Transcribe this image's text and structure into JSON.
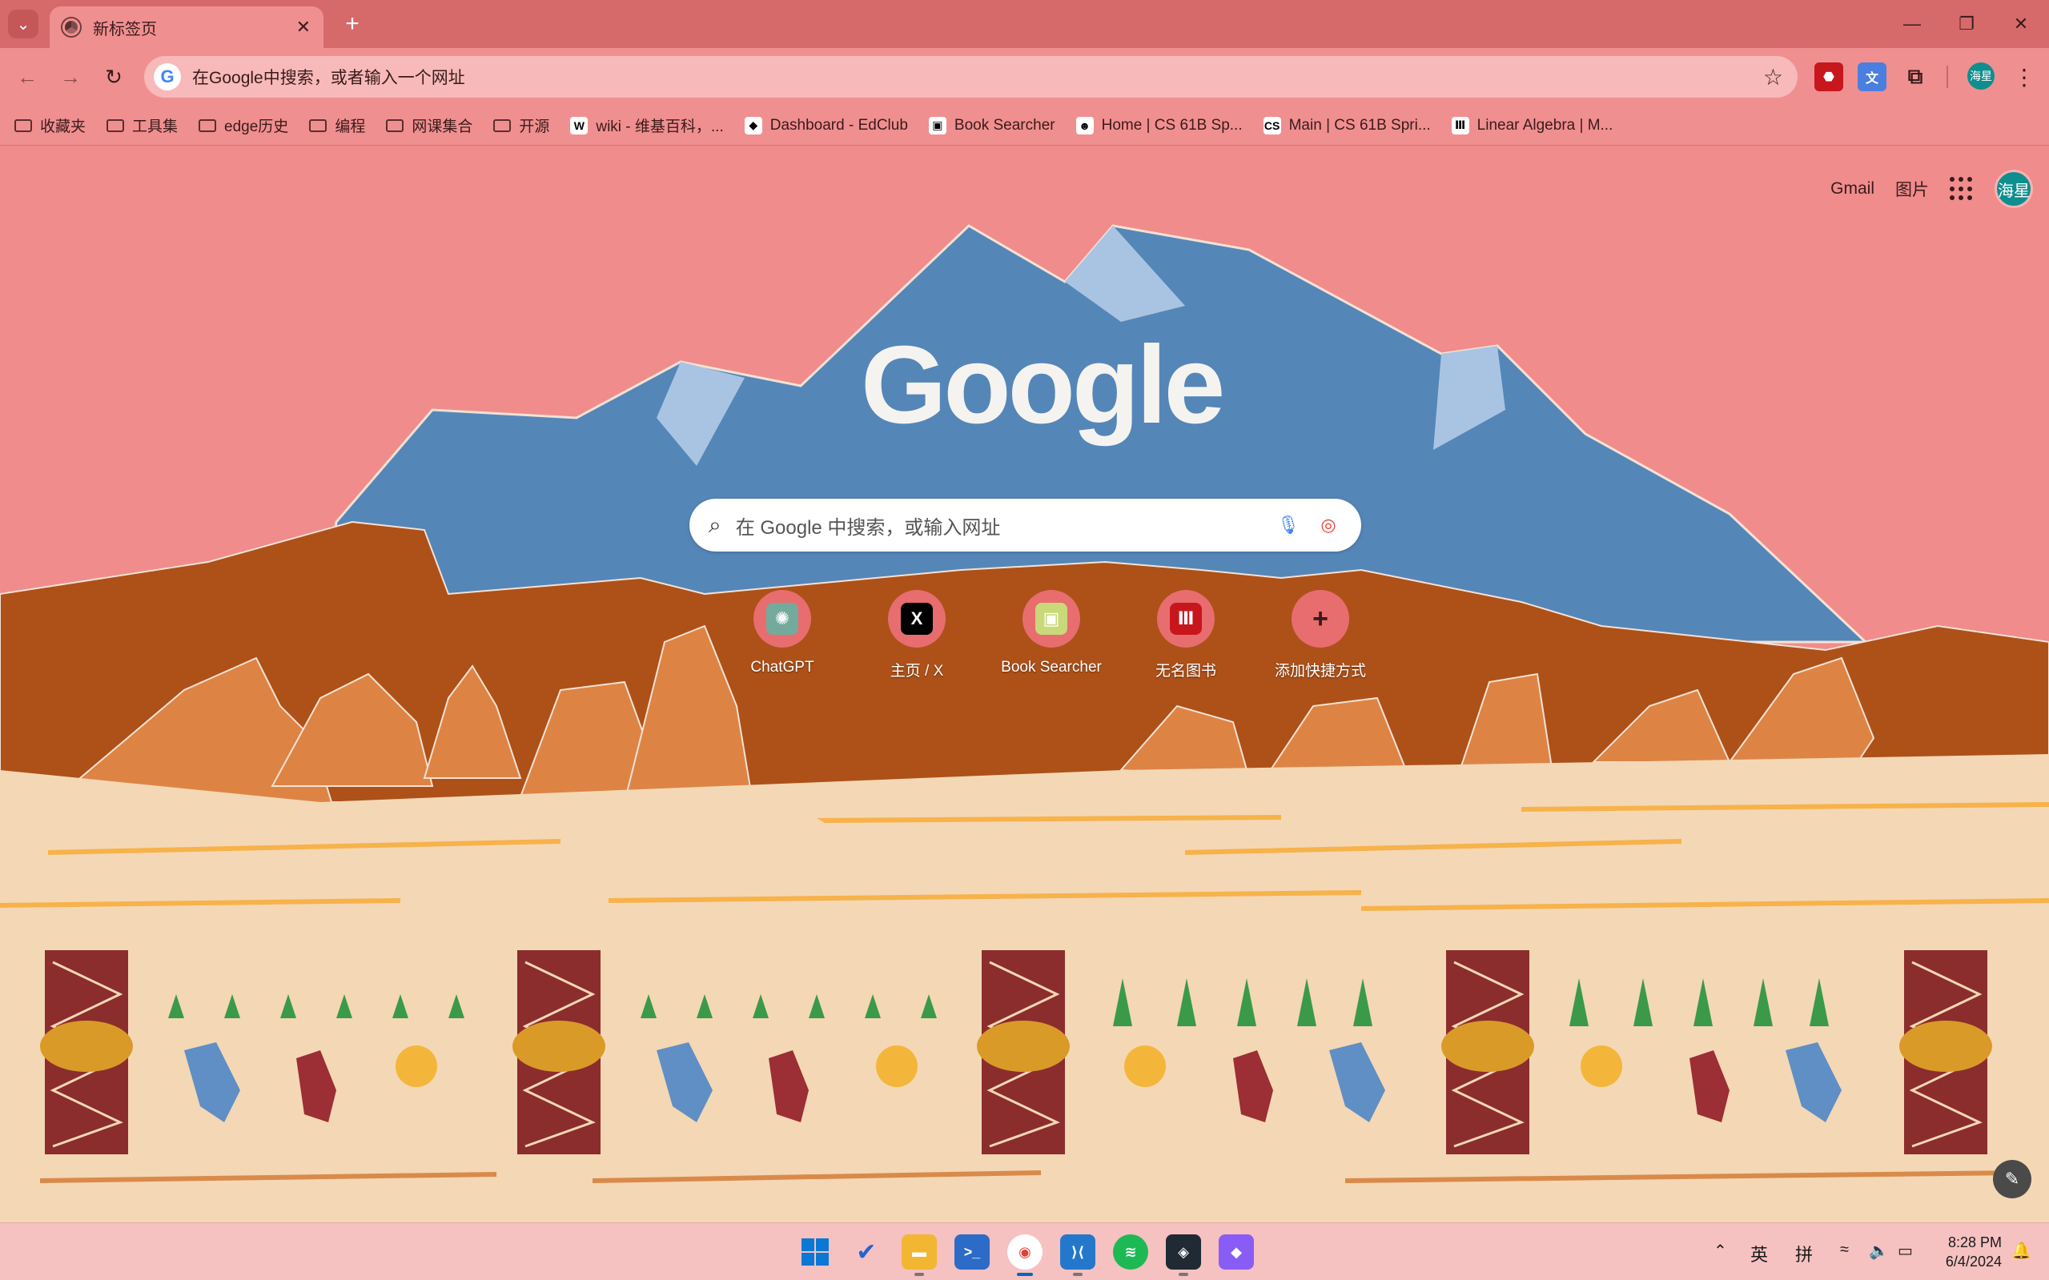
{
  "browser": {
    "tab_title": "新标签页",
    "omnibox_text": "在Google中搜索，或者输入一个网址"
  },
  "bookmarks": [
    {
      "label": "收藏夹",
      "type": "folder"
    },
    {
      "label": "工具集",
      "type": "folder"
    },
    {
      "label": "edge历史",
      "type": "folder"
    },
    {
      "label": "编程",
      "type": "folder"
    },
    {
      "label": "网课集合",
      "type": "folder"
    },
    {
      "label": "开源",
      "type": "folder"
    },
    {
      "label": "wiki - 维基百科，...",
      "type": "site",
      "glyph": "W"
    },
    {
      "label": "Dashboard - EdClub",
      "type": "site",
      "glyph": "◆"
    },
    {
      "label": "Book Searcher",
      "type": "site",
      "glyph": "▣"
    },
    {
      "label": "Home | CS 61B Sp...",
      "type": "site",
      "glyph": "☻"
    },
    {
      "label": "Main | CS 61B Spri...",
      "type": "site",
      "glyph": "CS"
    },
    {
      "label": "Linear Algebra | M...",
      "type": "site",
      "glyph": "Ⅲ"
    }
  ],
  "newtab": {
    "links": {
      "gmail": "Gmail",
      "images": "图片"
    },
    "profile_initials": "海星",
    "logo_text": "Google",
    "search_placeholder": "在 Google 中搜索，或输入网址",
    "shortcuts": [
      {
        "label": "ChatGPT",
        "glyph": "✺",
        "color": "#74aa9c"
      },
      {
        "label": "主页 / X",
        "glyph": "X",
        "color": "#000000"
      },
      {
        "label": "Book Searcher",
        "glyph": "▣",
        "color": "#c9d97a"
      },
      {
        "label": "无名图书",
        "glyph": "Ⅲ",
        "color": "#c8161d"
      },
      {
        "label": "添加快捷方式",
        "glyph": "+",
        "color": "#e86d6f"
      }
    ]
  },
  "taskbar": {
    "tray": {
      "input_mode": "英",
      "ime": "拼"
    },
    "time": "8:28 PM",
    "date": "6/4/2024"
  },
  "colors": {
    "titlebar": "#d66a6b",
    "toolbar": "#f08f90",
    "sky": "#f08c8c",
    "mountain": "#5586b8",
    "rock_dark": "#ad5119",
    "rock_light": "#dd8445",
    "sand": "#f4d7b5"
  }
}
